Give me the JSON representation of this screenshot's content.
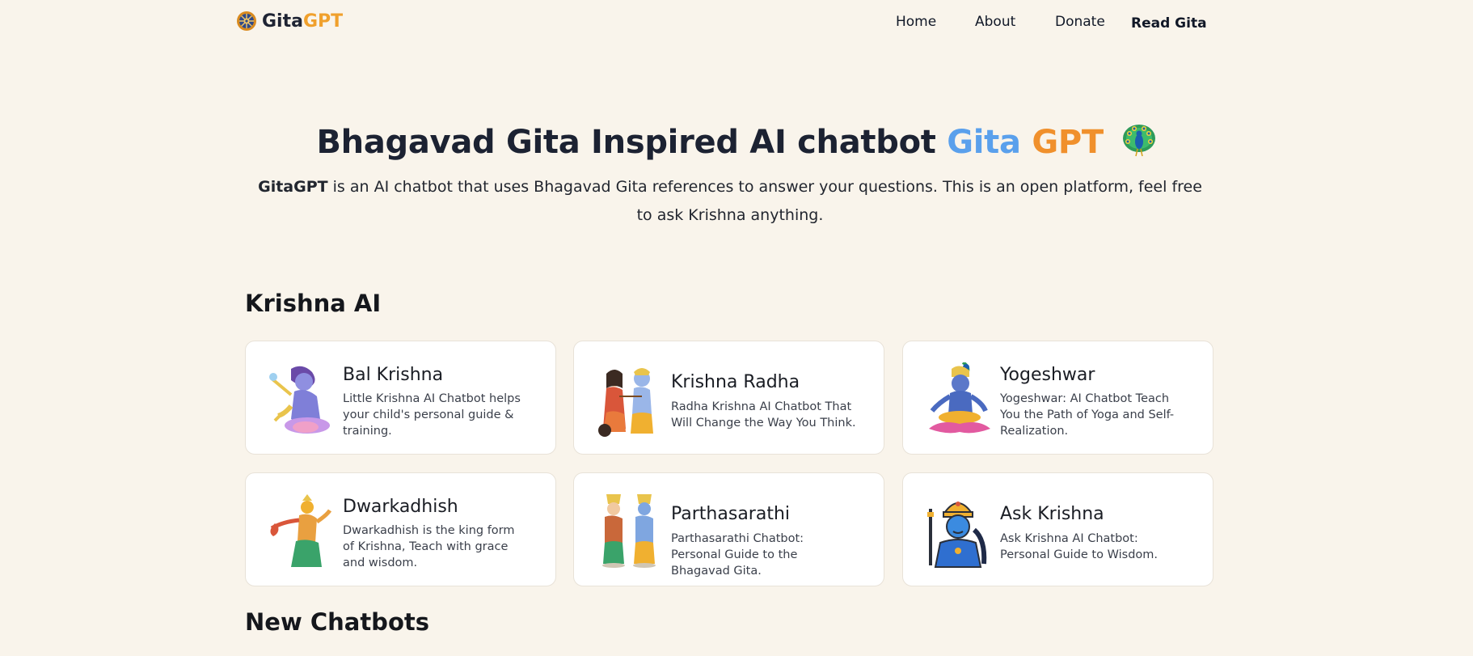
{
  "header": {
    "brand_gita": "Gita",
    "brand_gpt": "GPT",
    "nav": {
      "home": "Home",
      "about": "About",
      "donate": "Donate",
      "read_gita": "Read Gita"
    }
  },
  "hero": {
    "title_main": "Bhagavad Gita Inspired AI chatbot",
    "title_gita": "Gita",
    "title_gpt": "GPT",
    "desc_brand": "GitaGPT",
    "desc_text": "is an AI chatbot that uses Bhagavad Gita references to answer your questions. This is an open platform, feel free to ask Krishna anything."
  },
  "sections": {
    "krishna_ai": "Krishna AI",
    "new_chatbots": "New Chatbots"
  },
  "cards": [
    {
      "title": "Bal Krishna",
      "desc": "Little Krishna AI Chatbot helps your child's personal guide & training.",
      "icon": "bal-krishna-illustration"
    },
    {
      "title": "Krishna Radha",
      "desc": "Radha Krishna AI Chatbot That Will Change the Way You Think.",
      "icon": "krishna-radha-illustration"
    },
    {
      "title": "Yogeshwar",
      "desc": "Yogeshwar: AI Chatbot Teach You the Path of Yoga and Self-Realization.",
      "icon": "yogeshwar-illustration"
    },
    {
      "title": "Dwarkadhish",
      "desc": "Dwarkadhish is the king form of Krishna, Teach with grace and wisdom.",
      "icon": "dwarkadhish-illustration"
    },
    {
      "title": "Parthasarathi",
      "desc": "Parthasarathi Chatbot: Personal Guide to the Bhagavad Gita.",
      "icon": "parthasarathi-illustration"
    },
    {
      "title": "Ask Krishna",
      "desc": "Ask Krishna AI Chatbot: Personal Guide to Wisdom.",
      "icon": "ask-krishna-illustration"
    }
  ],
  "colors": {
    "background": "#f9f4eb",
    "brand_orange": "#f0a02c",
    "gita_blue": "#5aa0ec",
    "gpt_orange": "#f0902c",
    "card_bg": "#ffffff"
  }
}
